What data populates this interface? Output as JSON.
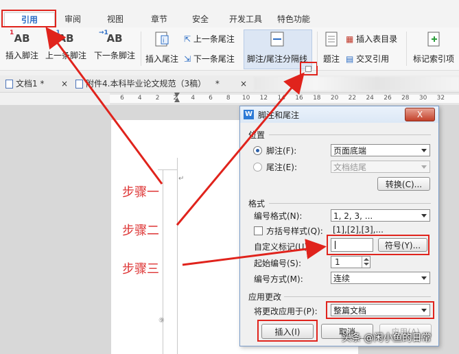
{
  "ribbon_tabs": [
    {
      "label": "引用",
      "active": true
    },
    {
      "label": "审阅"
    },
    {
      "label": "视图"
    },
    {
      "label": "章节"
    },
    {
      "label": "安全"
    },
    {
      "label": "开发工具"
    },
    {
      "label": "特色功能"
    }
  ],
  "ribbon": {
    "insert_footnote": "插入脚注",
    "prev_footnote": "上一条脚注",
    "next_footnote": "下一条脚注",
    "insert_endnote": "插入尾注",
    "prev_endnote": "上一条尾注",
    "next_endnote": "下一条尾注",
    "separator_line": "脚注/尾注分隔线",
    "caption": "题注",
    "insert_table_of_figures": "插入表目录",
    "cross_reference": "交叉引用",
    "mark_index": "标记索引项",
    "ab_text": "AB",
    "badge_1": "1"
  },
  "doc_tabs": [
    {
      "label": "文档1 *",
      "close": "×"
    },
    {
      "label": "附件4.本科毕业论文规范（3稿）",
      "modified": "*",
      "close": "×"
    }
  ],
  "ruler": {
    "ticks": [
      "6",
      "4",
      "2",
      "2",
      "4",
      "6",
      "8",
      "10",
      "12",
      "14",
      "16",
      "18",
      "20",
      "22",
      "24",
      "26",
      "28",
      "30",
      "32"
    ]
  },
  "steps": [
    "步骤一",
    "步骤二",
    "步骤三"
  ],
  "page_marks": {
    "top": "↵",
    "bottom": "⑨"
  },
  "dialog": {
    "title": "脚注和尾注",
    "icon_letter": "W",
    "close": "X",
    "position_section": "位置",
    "footnote_label": "脚注(F):",
    "footnote_value": "页面底端",
    "endnote_label": "尾注(E):",
    "endnote_value": "文档结尾",
    "convert_button": "转换(C)...",
    "format_section": "格式",
    "number_format_label": "编号格式(N):",
    "number_format_value": "1, 2, 3, ...",
    "bracket_label": "方括号样式(Q):",
    "bracket_example": "[1],[2],[3],...",
    "custom_mark_label": "自定义标记(U):",
    "custom_mark_value": "",
    "symbol_button": "符号(Y)...",
    "start_at_label": "起始编号(S):",
    "start_at_value": "1",
    "numbering_label": "编号方式(M):",
    "numbering_value": "连续",
    "apply_section": "应用更改",
    "apply_to_label": "将更改应用于(P):",
    "apply_to_value": "整篇文档",
    "insert_button": "插入(I)",
    "cancel_button": "取消",
    "apply_button": "应用(A)"
  },
  "watermark": "头条 @闲小鱼的日常",
  "colors": {
    "annotation_red": "#e0231c",
    "accent_blue": "#2b6cc4"
  }
}
